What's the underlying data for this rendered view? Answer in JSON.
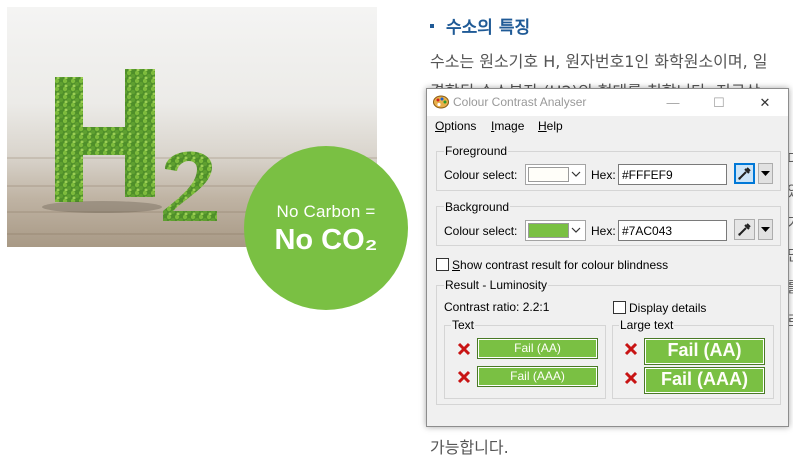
{
  "page": {
    "section_title": "수소의 특징",
    "lines": [
      "수소는 원소기호 H, 원자번호1인 화학원소이며, 일",
      "결합된 수소분자 (H2)의 형태를 칭합니다. 지구상",
      "가능합니다."
    ],
    "edge_fragments": [
      "다",
      "있",
      "가",
      "단",
      "를",
      "로"
    ],
    "hero": {
      "h2_glyph": "H",
      "h2_subscript": "2",
      "badge_line1": "No Carbon =",
      "badge_line2": "No CO₂",
      "brand_color": "#7ac043"
    }
  },
  "cca": {
    "title": "Colour Contrast Analyser",
    "icon": "palette-icon",
    "window_buttons": {
      "minimize": "—",
      "maximize": "☐",
      "close": "✕"
    },
    "menu": [
      {
        "label": "Options",
        "underline": "O",
        "rest": "ptions"
      },
      {
        "label": "Image",
        "underline": "I",
        "rest": "mage"
      },
      {
        "label": "Help",
        "underline": "H",
        "rest": "elp"
      }
    ],
    "foreground": {
      "group_label": "Foreground",
      "colour_select_label": "Colour select:",
      "hex_label": "Hex:",
      "hex_value": "#FFFEF9",
      "swatch_color": "#FFFEF9"
    },
    "background": {
      "group_label": "Background",
      "colour_select_label": "Colour select:",
      "hex_label": "Hex:",
      "hex_value": "#7AC043",
      "swatch_color": "#7AC043"
    },
    "colour_blindness": {
      "label": "Show contrast result for colour blindness",
      "underline": "S",
      "rest": "how contrast result for colour blindness",
      "checked": false
    },
    "result": {
      "group_label": "Result - Luminosity",
      "contrast_ratio": "Contrast ratio: 2.2:1",
      "display_details_label": "Display details",
      "display_details_checked": false,
      "text_group_label": "Text",
      "large_text_group_label": "Large text",
      "text_aa": "Fail (AA)",
      "text_aaa": "Fail (AAA)",
      "large_aa": "Fail (AA)",
      "large_aaa": "Fail (AAA)",
      "fail_icon": "red-x-icon"
    }
  }
}
